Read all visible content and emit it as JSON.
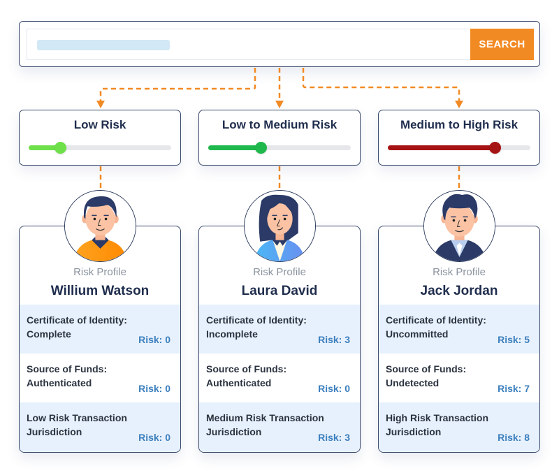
{
  "search": {
    "placeholder": "",
    "button_label": "SEARCH",
    "button_color": "#f28a24"
  },
  "connector_color": "#f28a24",
  "risk_levels": [
    {
      "label": "Low Risk",
      "level_percent": 22,
      "color": "#6ee04a"
    },
    {
      "label": "Low to Medium Risk",
      "level_percent": 37,
      "color": "#1fb84d"
    },
    {
      "label": "Medium to High Risk",
      "level_percent": 75,
      "color": "#a51314"
    }
  ],
  "profiles": [
    {
      "section_label": "Risk Profile",
      "name": "Willium Watson",
      "avatar": "man-orange-shirt-avatar",
      "items": [
        {
          "text": "Certificate of Identity: Complete",
          "risk": "Risk: 0"
        },
        {
          "text": "Source of Funds: Authenticated",
          "risk": "Risk: 0"
        },
        {
          "text": "Low Risk Transaction Jurisdiction",
          "risk": "Risk: 0"
        }
      ]
    },
    {
      "section_label": "Risk Profile",
      "name": "Laura David",
      "avatar": "woman-blue-vest-avatar",
      "items": [
        {
          "text": "Certificate of Identity: Incomplete",
          "risk": "Risk: 3"
        },
        {
          "text": "Source of Funds: Authenticated",
          "risk": "Risk: 0"
        },
        {
          "text": "Medium Risk Transaction Jurisdiction",
          "risk": "Risk: 3"
        }
      ]
    },
    {
      "section_label": "Risk Profile",
      "name": "Jack Jordan",
      "avatar": "man-navy-suit-avatar",
      "items": [
        {
          "text": "Certificate of Identity: Uncommitted",
          "risk": "Risk: 5"
        },
        {
          "text": "Source of Funds: Undetected",
          "risk": "Risk: 7"
        },
        {
          "text": "High Risk Transaction Jurisdiction",
          "risk": "Risk: 8"
        }
      ]
    }
  ]
}
